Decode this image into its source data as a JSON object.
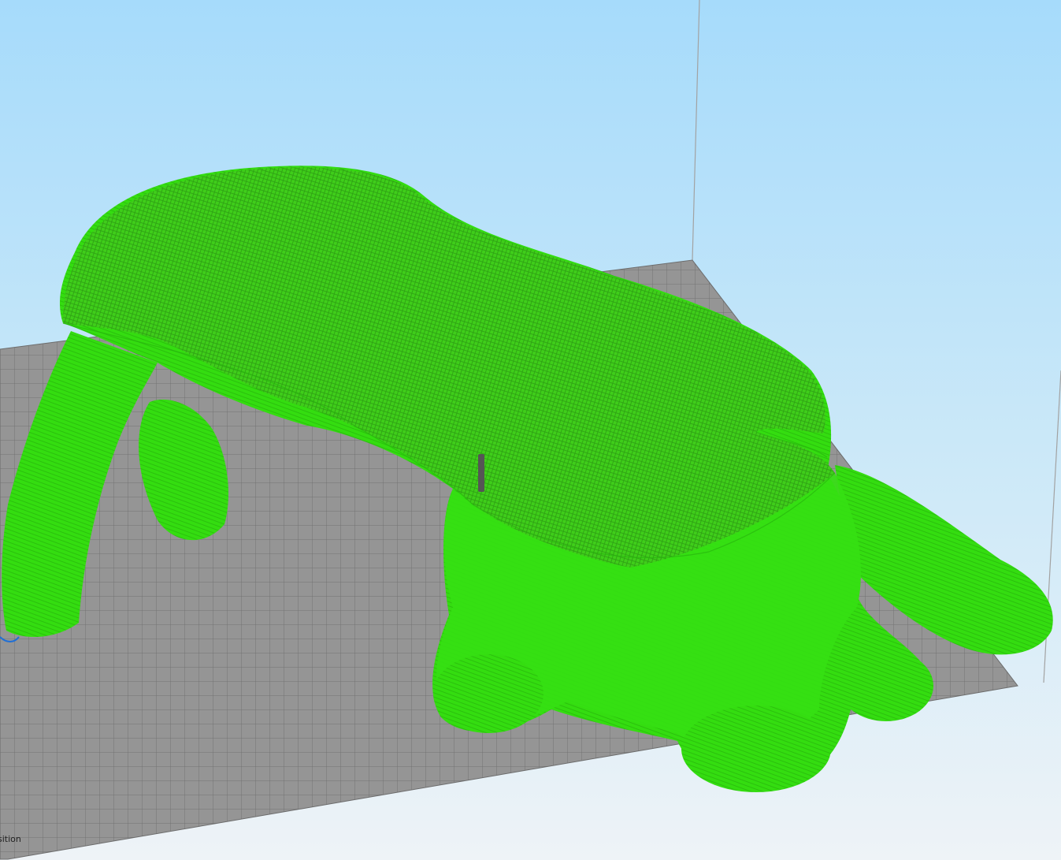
{
  "viewport": {
    "status_text": "sition",
    "background_top_color": "#a9dcfb",
    "background_bottom_color": "#f0f4f8"
  },
  "build_plate": {
    "surface_color": "#909090",
    "grid_line_color": "#6d6d6d"
  },
  "model": {
    "fill_color": "#33dd11",
    "top_layer_color": "#44c820",
    "infill_pattern_color": "#2a9d12"
  },
  "nozzle": {
    "color": "#555555"
  },
  "build_volume": {
    "edge_color": "#9a9a9a"
  },
  "icons": {
    "origin_marker": "axis-origin-icon"
  }
}
